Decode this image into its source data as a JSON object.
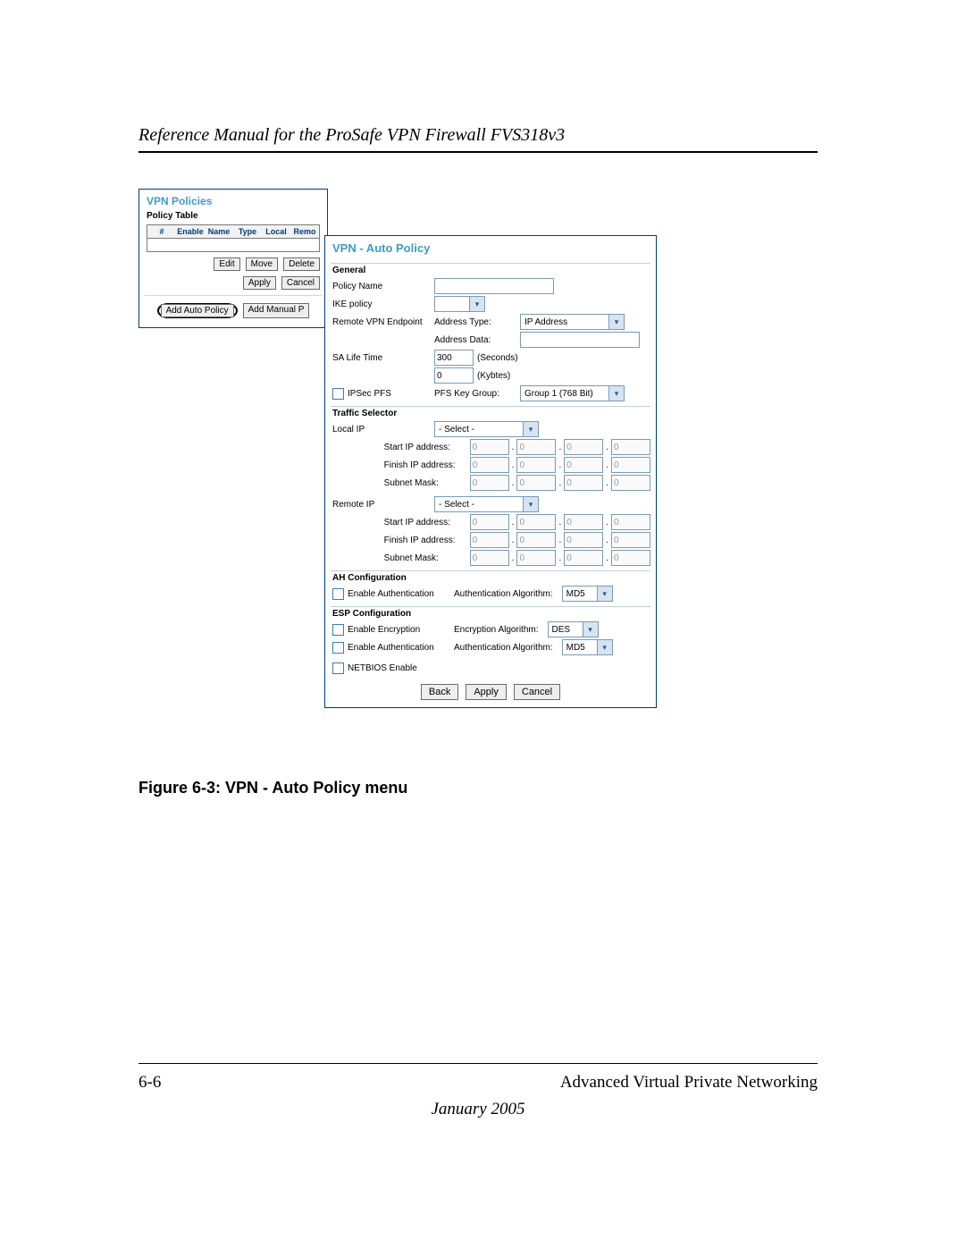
{
  "header": {
    "title": "Reference Manual for the ProSafe VPN Firewall FVS318v3"
  },
  "back": {
    "title": "VPN Policies",
    "subtitle": "Policy Table",
    "cols": [
      "#",
      "Enable",
      "Name",
      "Type",
      "Local",
      "Remo"
    ],
    "btns": {
      "edit": "Edit",
      "move": "Move",
      "delete": "Delete",
      "apply": "Apply",
      "cancel": "Cancel",
      "addAuto": "Add Auto Policy",
      "addManual": "Add Manual P"
    }
  },
  "front": {
    "title": "VPN - Auto Policy",
    "general": {
      "heading": "General",
      "policyName": "Policy Name",
      "policyNameVal": "",
      "ike": "IKE policy",
      "remote": "Remote VPN Endpoint",
      "addrType": "Address Type:",
      "addrTypeVal": "IP Address",
      "addrData": "Address Data:",
      "sa": "SA Life Time",
      "saSec": "300",
      "secLabel": "(Seconds)",
      "saKb": "0",
      "kbLabel": "(Kybtes)",
      "pfs": "IPSec PFS",
      "pfsKey": "PFS Key Group:",
      "pfsVal": "Group 1 (768 Bit)"
    },
    "ts": {
      "heading": "Traffic Selector",
      "local": "Local IP",
      "remoteIp": "Remote IP",
      "selectPh": "- Select -",
      "start": "Start IP address:",
      "finish": "Finish IP address:",
      "mask": "Subnet Mask:"
    },
    "ah": {
      "heading": "AH Configuration",
      "enable": "Enable Authentication",
      "algo": "Authentication Algorithm:",
      "val": "MD5"
    },
    "esp": {
      "heading": "ESP Configuration",
      "enc": "Enable Encryption",
      "encAlgo": "Encryption Algorithm:",
      "encVal": "DES",
      "auth": "Enable Authentication",
      "authAlgo": "Authentication Algorithm:",
      "authVal": "MD5",
      "netbios": "NETBIOS Enable"
    },
    "buttons": {
      "back": "Back",
      "apply": "Apply",
      "cancel": "Cancel"
    }
  },
  "caption": "Figure 6-3: VPN - Auto Policy menu",
  "footer": {
    "page": "6-6",
    "chapter": "Advanced Virtual Private Networking",
    "date": "January 2005"
  }
}
